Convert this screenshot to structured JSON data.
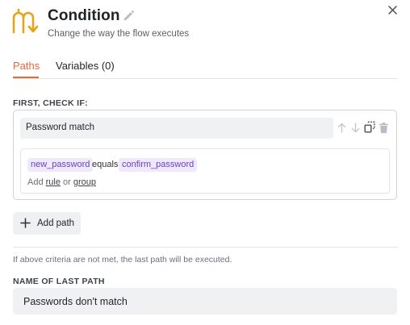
{
  "header": {
    "title": "Condition",
    "subtitle": "Change the way the flow executes",
    "icon": "condition-branch-icon",
    "accent_color": "#e8a317"
  },
  "tabs": [
    {
      "label": "Paths",
      "active": true
    },
    {
      "label": "Variables (0)",
      "active": false
    }
  ],
  "colors": {
    "accent": "#e5683a",
    "chip_bg": "#efe9fb",
    "chip_text": "#6a3fc7"
  },
  "paths_section": {
    "label": "FIRST, CHECK IF:",
    "path": {
      "name": "Password match",
      "rule": {
        "left": "new_password",
        "operator": "equals",
        "right": "confirm_password"
      },
      "add_rule": {
        "prefix": "Add",
        "rule_link": "rule",
        "conjunction": "or",
        "group_link": "group"
      }
    },
    "add_path_label": "Add path"
  },
  "fallback": {
    "note": "If above criteria are not met, the last path will be executed.",
    "label": "NAME OF LAST PATH",
    "value": "Passwords don't match"
  }
}
